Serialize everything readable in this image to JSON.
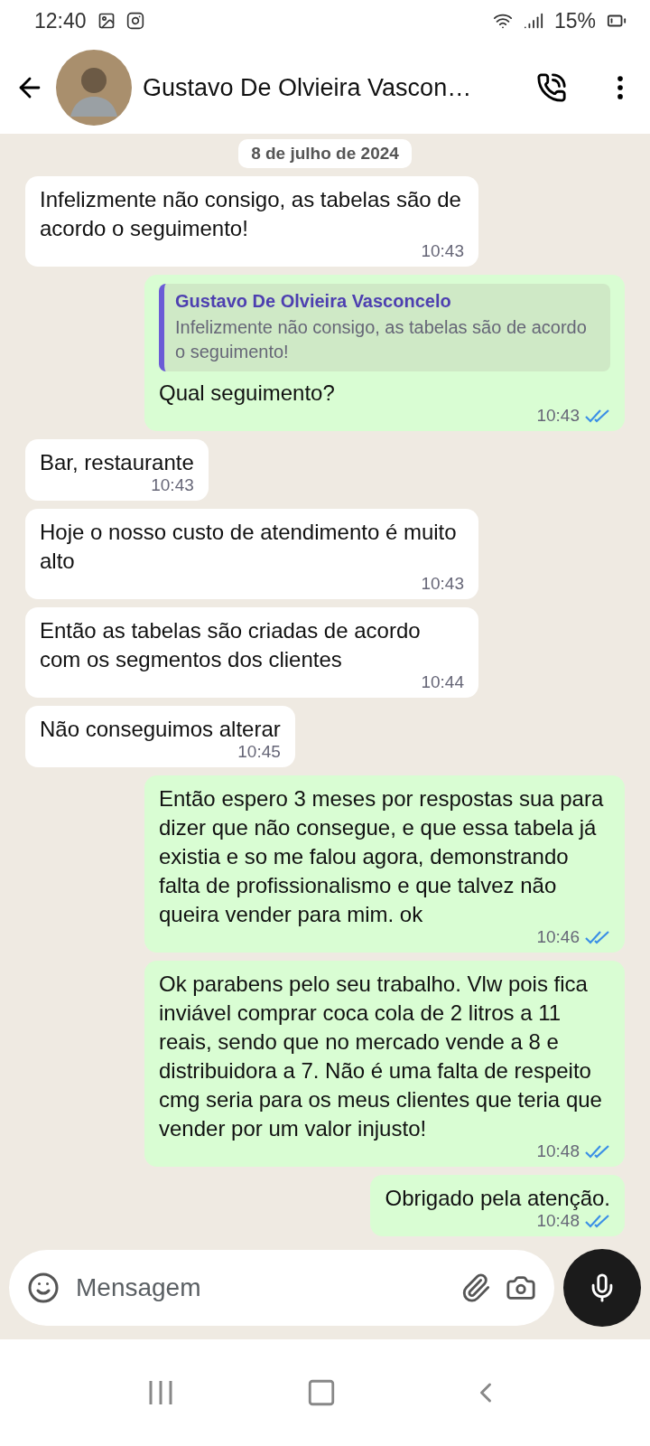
{
  "status_bar": {
    "time": "12:40",
    "battery": "15%"
  },
  "header": {
    "contact_name": "Gustavo De Olvieira Vascon…"
  },
  "date_chip": "8 de julho de 2024",
  "messages": [
    {
      "kind": "in",
      "text": "Infelizmente não consigo,  as tabelas são de acordo o seguimento!",
      "time": "10:43"
    },
    {
      "kind": "out",
      "quote": {
        "author": "Gustavo De Olvieira Vasconcelo",
        "text": "Infelizmente não consigo,  as tabelas são de acordo o seguimento!"
      },
      "text": "Qual seguimento?",
      "time": "10:43",
      "read": true
    },
    {
      "kind": "in",
      "text": "Bar, restaurante",
      "time": "10:43"
    },
    {
      "kind": "in",
      "text": "Hoje o nosso custo de atendimento é muito alto",
      "time": "10:43"
    },
    {
      "kind": "in",
      "text": "Então as tabelas são criadas de acordo com os segmentos dos clientes",
      "time": "10:44"
    },
    {
      "kind": "in",
      "text": "Não conseguimos alterar",
      "time": "10:45"
    },
    {
      "kind": "out",
      "text": "Então espero 3 meses por respostas sua para dizer que não consegue, e que essa tabela já existia e so me falou agora, demonstrando falta de profissionalismo e que talvez não queira vender para mim. ok",
      "time": "10:46",
      "read": true
    },
    {
      "kind": "out",
      "text": "Ok parabens pelo seu trabalho. Vlw pois fica inviável comprar coca cola de 2 litros a 11 reais, sendo que no mercado vende a 8 e distribuidora a 7. Não é uma falta de respeito cmg seria para os meus clientes que teria que vender por um valor injusto!",
      "time": "10:48",
      "read": true
    },
    {
      "kind": "out",
      "text": "Obrigado pela atenção.",
      "time": "10:48",
      "read": true
    }
  ],
  "composer": {
    "placeholder": "Mensagem"
  }
}
